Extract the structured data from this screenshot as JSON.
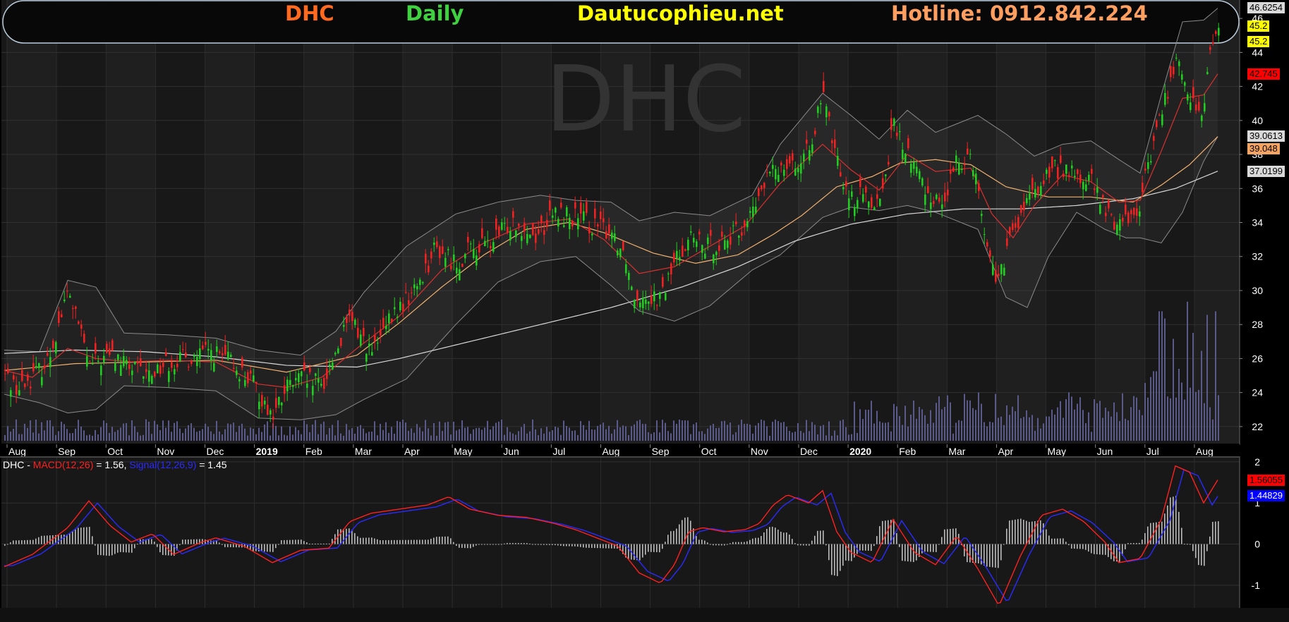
{
  "header": {
    "ticker": "DHC",
    "period": "Daily",
    "site": "Dautucophieu.net",
    "hotline": "Hotline: 0912.842.224",
    "watermark": "DHC",
    "colors": {
      "ticker": "#ff6a1f",
      "period": "#3fd13f",
      "site": "#ffff00",
      "hotline": "#ff9f5f"
    }
  },
  "price_tags": [
    {
      "text": "46.6254",
      "value": 46.6254,
      "bg": "#d9d9d9",
      "fg": "#000000"
    },
    {
      "text": "45.2",
      "value": 45.55,
      "bg": "#ffff00",
      "fg": "#000000"
    },
    {
      "text": "45.2",
      "value": 44.65,
      "bg": "#ffff00",
      "fg": "#000000"
    },
    {
      "text": "42.745",
      "value": 42.745,
      "bg": "#ff0000",
      "fg": "#000000"
    },
    {
      "text": "39.0613",
      "value": 39.0613,
      "bg": "#d9d9d9",
      "fg": "#000000"
    },
    {
      "text": "39.048",
      "value": 38.35,
      "bg": "#f4a460",
      "fg": "#000000"
    },
    {
      "text": "37.0199",
      "value": 37.0199,
      "bg": "#d9d9d9",
      "fg": "#000000"
    }
  ],
  "macd_tags": [
    {
      "text": "1.56055",
      "value": 1.56,
      "bg": "#ff0000",
      "fg": "#000000"
    },
    {
      "text": "1.44829",
      "value": 1.18,
      "bg": "#0000ff",
      "fg": "#ffffff"
    }
  ],
  "macd_label": {
    "prefix": "DHC - ",
    "macd": "MACD(12,26)",
    "macd_value": " = 1.56, ",
    "signal": "Signal(12,26,9)",
    "signal_value": " = 1.45"
  },
  "chart_data": [
    {
      "type": "candlestick",
      "ylim": [
        21,
        47
      ],
      "yticks": [
        22,
        24,
        26,
        28,
        30,
        32,
        34,
        36,
        38,
        40,
        42,
        44,
        46
      ],
      "x_labels": [
        "Aug",
        "Sep",
        "Oct",
        "Nov",
        "Dec",
        "2019",
        "Feb",
        "Mar",
        "Apr",
        "May",
        "Jun",
        "Jul",
        "Aug",
        "Sep",
        "Oct",
        "Nov",
        "Dec",
        "2020",
        "Feb",
        "Mar",
        "Apr",
        "May",
        "Jun",
        "Jul",
        "Aug"
      ],
      "bold_labels": [
        "2019",
        "2020"
      ],
      "close_anchors": [
        [
          0,
          25.0
        ],
        [
          20,
          24.2
        ],
        [
          60,
          25.8
        ],
        [
          90,
          30.0
        ],
        [
          120,
          25.6
        ],
        [
          150,
          26.2
        ],
        [
          175,
          25.5
        ],
        [
          200,
          25.0
        ],
        [
          230,
          25.8
        ],
        [
          260,
          26.0
        ],
        [
          290,
          26.4
        ],
        [
          320,
          25.8
        ],
        [
          350,
          24.6
        ],
        [
          380,
          22.6
        ],
        [
          400,
          24.3
        ],
        [
          420,
          24.8
        ],
        [
          450,
          24.4
        ],
        [
          470,
          26.6
        ],
        [
          490,
          28.3
        ],
        [
          520,
          26.3
        ],
        [
          550,
          28.5
        ],
        [
          580,
          30.0
        ],
        [
          610,
          32.5
        ],
        [
          640,
          31.6
        ],
        [
          660,
          32.4
        ],
        [
          690,
          32.8
        ],
        [
          720,
          34.2
        ],
        [
          750,
          33.2
        ],
        [
          780,
          34.5
        ],
        [
          810,
          34.3
        ],
        [
          840,
          33.7
        ],
        [
          860,
          33.5
        ],
        [
          880,
          32.0
        ],
        [
          890,
          29.8
        ],
        [
          910,
          29.8
        ],
        [
          930,
          29.5
        ],
        [
          950,
          31.8
        ],
        [
          970,
          33.2
        ],
        [
          990,
          32.5
        ],
        [
          1010,
          32.8
        ],
        [
          1040,
          33.4
        ],
        [
          1060,
          34.6
        ],
        [
          1080,
          36.6
        ],
        [
          1110,
          37.8
        ],
        [
          1130,
          37.2
        ],
        [
          1150,
          40.0
        ],
        [
          1160,
          41.3
        ],
        [
          1180,
          37.5
        ],
        [
          1200,
          35.4
        ],
        [
          1220,
          35.6
        ],
        [
          1240,
          35.2
        ],
        [
          1260,
          39.8
        ],
        [
          1270,
          38.7
        ],
        [
          1290,
          37.2
        ],
        [
          1310,
          35.6
        ],
        [
          1330,
          35.2
        ],
        [
          1350,
          37.6
        ],
        [
          1370,
          38.1
        ],
        [
          1380,
          35.8
        ],
        [
          1395,
          31.8
        ],
        [
          1410,
          30.6
        ],
        [
          1420,
          32.4
        ],
        [
          1440,
          34.5
        ],
        [
          1460,
          35.8
        ],
        [
          1480,
          37.0
        ],
        [
          1500,
          37.2
        ],
        [
          1520,
          36.6
        ],
        [
          1540,
          36.4
        ],
        [
          1560,
          34.6
        ],
        [
          1575,
          34.0
        ],
        [
          1590,
          34.3
        ],
        [
          1610,
          35.0
        ],
        [
          1620,
          37.6
        ],
        [
          1630,
          39.0
        ],
        [
          1645,
          41.5
        ],
        [
          1660,
          43.4
        ],
        [
          1680,
          41.6
        ],
        [
          1690,
          39.8
        ],
        [
          1700,
          41.2
        ],
        [
          1710,
          44.5
        ],
        [
          1720,
          45.4
        ]
      ],
      "volume_spikes": [
        [
          1620,
          3.6
        ],
        [
          1630,
          5.8
        ],
        [
          1638,
          10.8
        ],
        [
          1645,
          10.2
        ],
        [
          1655,
          8.5
        ],
        [
          1665,
          6.0
        ],
        [
          1675,
          11.6
        ],
        [
          1685,
          9.0
        ],
        [
          1695,
          7.5
        ],
        [
          1705,
          10.5
        ],
        [
          1715,
          10.8
        ]
      ],
      "sma_50": [
        [
          0,
          25.3
        ],
        [
          100,
          25.7
        ],
        [
          200,
          25.8
        ],
        [
          300,
          25.9
        ],
        [
          400,
          25.2
        ],
        [
          500,
          26.2
        ],
        [
          560,
          28.1
        ],
        [
          620,
          30.2
        ],
        [
          680,
          32.1
        ],
        [
          740,
          33.6
        ],
        [
          800,
          34.0
        ],
        [
          850,
          33.4
        ],
        [
          920,
          32.2
        ],
        [
          980,
          31.6
        ],
        [
          1040,
          32.1
        ],
        [
          1090,
          33.3
        ],
        [
          1130,
          34.4
        ],
        [
          1180,
          36.1
        ],
        [
          1230,
          36.7
        ],
        [
          1270,
          37.5
        ],
        [
          1320,
          37.7
        ],
        [
          1370,
          37.4
        ],
        [
          1420,
          36.1
        ],
        [
          1480,
          35.5
        ],
        [
          1540,
          35.5
        ],
        [
          1600,
          35.2
        ],
        [
          1640,
          36.2
        ],
        [
          1680,
          37.4
        ],
        [
          1720,
          39.05
        ]
      ],
      "sma_200": [
        [
          0,
          26.3
        ],
        [
          100,
          26.5
        ],
        [
          200,
          26.4
        ],
        [
          300,
          26.1
        ],
        [
          400,
          25.6
        ],
        [
          500,
          25.5
        ],
        [
          560,
          26.0
        ],
        [
          640,
          26.8
        ],
        [
          740,
          27.8
        ],
        [
          860,
          29.0
        ],
        [
          960,
          30.2
        ],
        [
          1040,
          31.4
        ],
        [
          1120,
          32.9
        ],
        [
          1200,
          33.9
        ],
        [
          1280,
          34.5
        ],
        [
          1360,
          34.8
        ],
        [
          1440,
          34.8
        ],
        [
          1520,
          35.0
        ],
        [
          1600,
          35.4
        ],
        [
          1660,
          36.0
        ],
        [
          1720,
          37.02
        ]
      ],
      "ema_20": [
        [
          0,
          25.3
        ],
        [
          40,
          24.9
        ],
        [
          90,
          26.6
        ],
        [
          130,
          26.0
        ],
        [
          180,
          25.8
        ],
        [
          230,
          25.9
        ],
        [
          300,
          25.8
        ],
        [
          360,
          24.5
        ],
        [
          400,
          24.3
        ],
        [
          450,
          24.9
        ],
        [
          500,
          26.6
        ],
        [
          560,
          28.5
        ],
        [
          620,
          31.2
        ],
        [
          680,
          32.8
        ],
        [
          740,
          33.9
        ],
        [
          800,
          34.2
        ],
        [
          850,
          33.0
        ],
        [
          900,
          31.0
        ],
        [
          950,
          31.4
        ],
        [
          1000,
          32.6
        ],
        [
          1050,
          33.8
        ],
        [
          1100,
          36.3
        ],
        [
          1160,
          38.6
        ],
        [
          1200,
          37.1
        ],
        [
          1240,
          35.9
        ],
        [
          1280,
          38.0
        ],
        [
          1320,
          37.0
        ],
        [
          1370,
          37.2
        ],
        [
          1400,
          34.5
        ],
        [
          1430,
          33.1
        ],
        [
          1460,
          35.0
        ],
        [
          1500,
          36.8
        ],
        [
          1540,
          36.4
        ],
        [
          1580,
          35.2
        ],
        [
          1610,
          35.3
        ],
        [
          1640,
          38.2
        ],
        [
          1670,
          41.3
        ],
        [
          1700,
          41.5
        ],
        [
          1720,
          42.74
        ]
      ],
      "bb_upper": [
        [
          0,
          26.5
        ],
        [
          50,
          26.4
        ],
        [
          90,
          30.6
        ],
        [
          130,
          30.2
        ],
        [
          170,
          27.5
        ],
        [
          230,
          27.4
        ],
        [
          300,
          27.2
        ],
        [
          360,
          26.5
        ],
        [
          420,
          26.2
        ],
        [
          470,
          27.6
        ],
        [
          510,
          29.9
        ],
        [
          570,
          32.6
        ],
        [
          640,
          34.5
        ],
        [
          700,
          35.2
        ],
        [
          760,
          35.6
        ],
        [
          810,
          35.3
        ],
        [
          860,
          35.2
        ],
        [
          900,
          34.1
        ],
        [
          950,
          34.6
        ],
        [
          1000,
          34.4
        ],
        [
          1060,
          35.6
        ],
        [
          1100,
          38.6
        ],
        [
          1160,
          41.6
        ],
        [
          1200,
          40.3
        ],
        [
          1240,
          38.9
        ],
        [
          1280,
          40.6
        ],
        [
          1320,
          39.3
        ],
        [
          1380,
          40.3
        ],
        [
          1420,
          39.2
        ],
        [
          1460,
          37.9
        ],
        [
          1500,
          38.6
        ],
        [
          1540,
          38.8
        ],
        [
          1580,
          37.7
        ],
        [
          1610,
          36.9
        ],
        [
          1640,
          41.5
        ],
        [
          1670,
          45.8
        ],
        [
          1700,
          45.9
        ],
        [
          1720,
          46.6
        ]
      ],
      "bb_lower": [
        [
          0,
          23.9
        ],
        [
          50,
          23.4
        ],
        [
          90,
          22.8
        ],
        [
          130,
          23.0
        ],
        [
          170,
          24.4
        ],
        [
          230,
          24.3
        ],
        [
          300,
          24.1
        ],
        [
          360,
          22.5
        ],
        [
          420,
          22.4
        ],
        [
          470,
          22.7
        ],
        [
          510,
          23.6
        ],
        [
          570,
          24.8
        ],
        [
          640,
          28.0
        ],
        [
          700,
          30.5
        ],
        [
          760,
          31.7
        ],
        [
          810,
          32.0
        ],
        [
          860,
          30.3
        ],
        [
          900,
          28.8
        ],
        [
          950,
          28.2
        ],
        [
          1000,
          29.1
        ],
        [
          1060,
          31.2
        ],
        [
          1100,
          32.1
        ],
        [
          1160,
          34.3
        ],
        [
          1200,
          34.9
        ],
        [
          1240,
          34.7
        ],
        [
          1280,
          35.0
        ],
        [
          1320,
          34.6
        ],
        [
          1380,
          33.6
        ],
        [
          1420,
          29.6
        ],
        [
          1450,
          29.0
        ],
        [
          1480,
          32.0
        ],
        [
          1520,
          34.6
        ],
        [
          1560,
          33.6
        ],
        [
          1590,
          33.1
        ],
        [
          1610,
          33.1
        ],
        [
          1640,
          32.8
        ],
        [
          1670,
          34.6
        ],
        [
          1700,
          37.6
        ],
        [
          1720,
          39.06
        ]
      ]
    },
    {
      "type": "line",
      "title": "MACD",
      "ylim": [
        -1.55,
        2.1
      ],
      "yticks": [
        2,
        1,
        0,
        -1
      ],
      "ytick_labels": [
        "2",
        "1",
        "0",
        "-1"
      ],
      "macd_anchors": [
        [
          0,
          -0.55
        ],
        [
          40,
          -0.25
        ],
        [
          90,
          0.4
        ],
        [
          120,
          1.05
        ],
        [
          150,
          0.45
        ],
        [
          180,
          0.05
        ],
        [
          210,
          0.25
        ],
        [
          240,
          -0.25
        ],
        [
          280,
          0.05
        ],
        [
          300,
          0.15
        ],
        [
          340,
          -0.05
        ],
        [
          380,
          -0.45
        ],
        [
          420,
          -0.15
        ],
        [
          460,
          -0.1
        ],
        [
          490,
          0.55
        ],
        [
          520,
          0.75
        ],
        [
          560,
          0.85
        ],
        [
          600,
          0.95
        ],
        [
          630,
          1.15
        ],
        [
          660,
          0.85
        ],
        [
          700,
          0.7
        ],
        [
          740,
          0.65
        ],
        [
          780,
          0.5
        ],
        [
          810,
          0.35
        ],
        [
          840,
          0.15
        ],
        [
          870,
          -0.05
        ],
        [
          900,
          -0.7
        ],
        [
          930,
          -0.95
        ],
        [
          950,
          -0.5
        ],
        [
          970,
          0.3
        ],
        [
          990,
          0.4
        ],
        [
          1020,
          0.3
        ],
        [
          1050,
          0.35
        ],
        [
          1070,
          0.5
        ],
        [
          1090,
          0.95
        ],
        [
          1110,
          1.2
        ],
        [
          1140,
          1.0
        ],
        [
          1160,
          1.3
        ],
        [
          1180,
          0.3
        ],
        [
          1200,
          -0.2
        ],
        [
          1230,
          -0.45
        ],
        [
          1260,
          0.6
        ],
        [
          1290,
          -0.2
        ],
        [
          1320,
          -0.5
        ],
        [
          1350,
          0.2
        ],
        [
          1380,
          -0.6
        ],
        [
          1410,
          -1.5
        ],
        [
          1440,
          -0.3
        ],
        [
          1470,
          0.7
        ],
        [
          1500,
          0.85
        ],
        [
          1530,
          0.55
        ],
        [
          1560,
          0.05
        ],
        [
          1580,
          -0.45
        ],
        [
          1610,
          -0.35
        ],
        [
          1640,
          0.6
        ],
        [
          1660,
          1.9
        ],
        [
          1680,
          1.75
        ],
        [
          1700,
          1.0
        ],
        [
          1720,
          1.56
        ]
      ],
      "signal_lag": 12
    }
  ]
}
